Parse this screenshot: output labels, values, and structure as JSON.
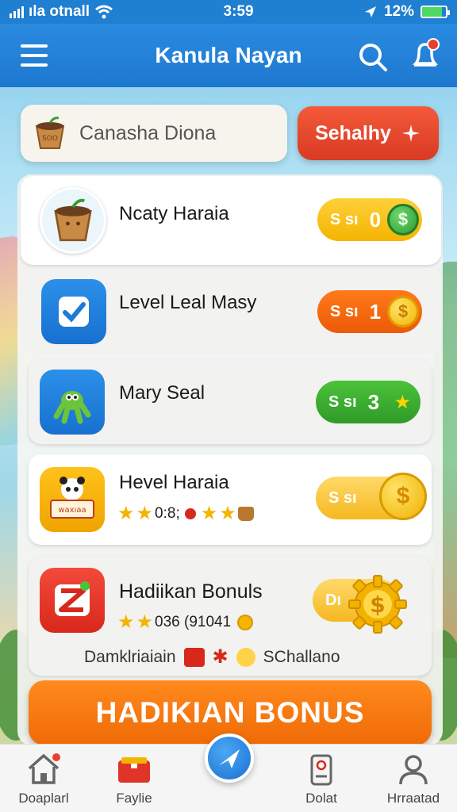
{
  "status_bar": {
    "carrier": "ıla otnall",
    "time": "3:59",
    "battery": "12%"
  },
  "header": {
    "title": "Kanula Nayan"
  },
  "search": {
    "placeholder": "Canasha Diona"
  },
  "cta_button": {
    "label": "Sehalhy"
  },
  "tasks": [
    {
      "name": "Ncaty Haraia",
      "reward_prefix": "S sı",
      "reward_amount": "0"
    },
    {
      "name": "Level Leal Masy",
      "reward_prefix": "S sı",
      "reward_amount": "1"
    },
    {
      "name": "Mary Seal",
      "reward_prefix": "S sı",
      "reward_amount": "3"
    },
    {
      "name": "Hevel Haraia",
      "reward_prefix": "S sı",
      "reward_amount": "",
      "detail": "0:8;",
      "icon_label": "waxıaa"
    },
    {
      "name": "Hadiikan Bonuls",
      "reward_prefix": "Dı",
      "reward_amount": "",
      "detail": "036 (91041"
    }
  ],
  "challenge_row": {
    "left": "Damklriaiain",
    "right": "SChallano"
  },
  "bonus_button": {
    "label": "HADIKIAN BONUS"
  },
  "nav": [
    {
      "label": "Doaplarl"
    },
    {
      "label": "Faylie"
    },
    {
      "label": "Dolat"
    },
    {
      "label": "Hrraatad"
    }
  ],
  "colors": {
    "primary": "#1f7fd1",
    "cta": "#e2452c",
    "orange": "#f57a0f",
    "green": "#3fa63a",
    "gold": "#f4b400"
  }
}
